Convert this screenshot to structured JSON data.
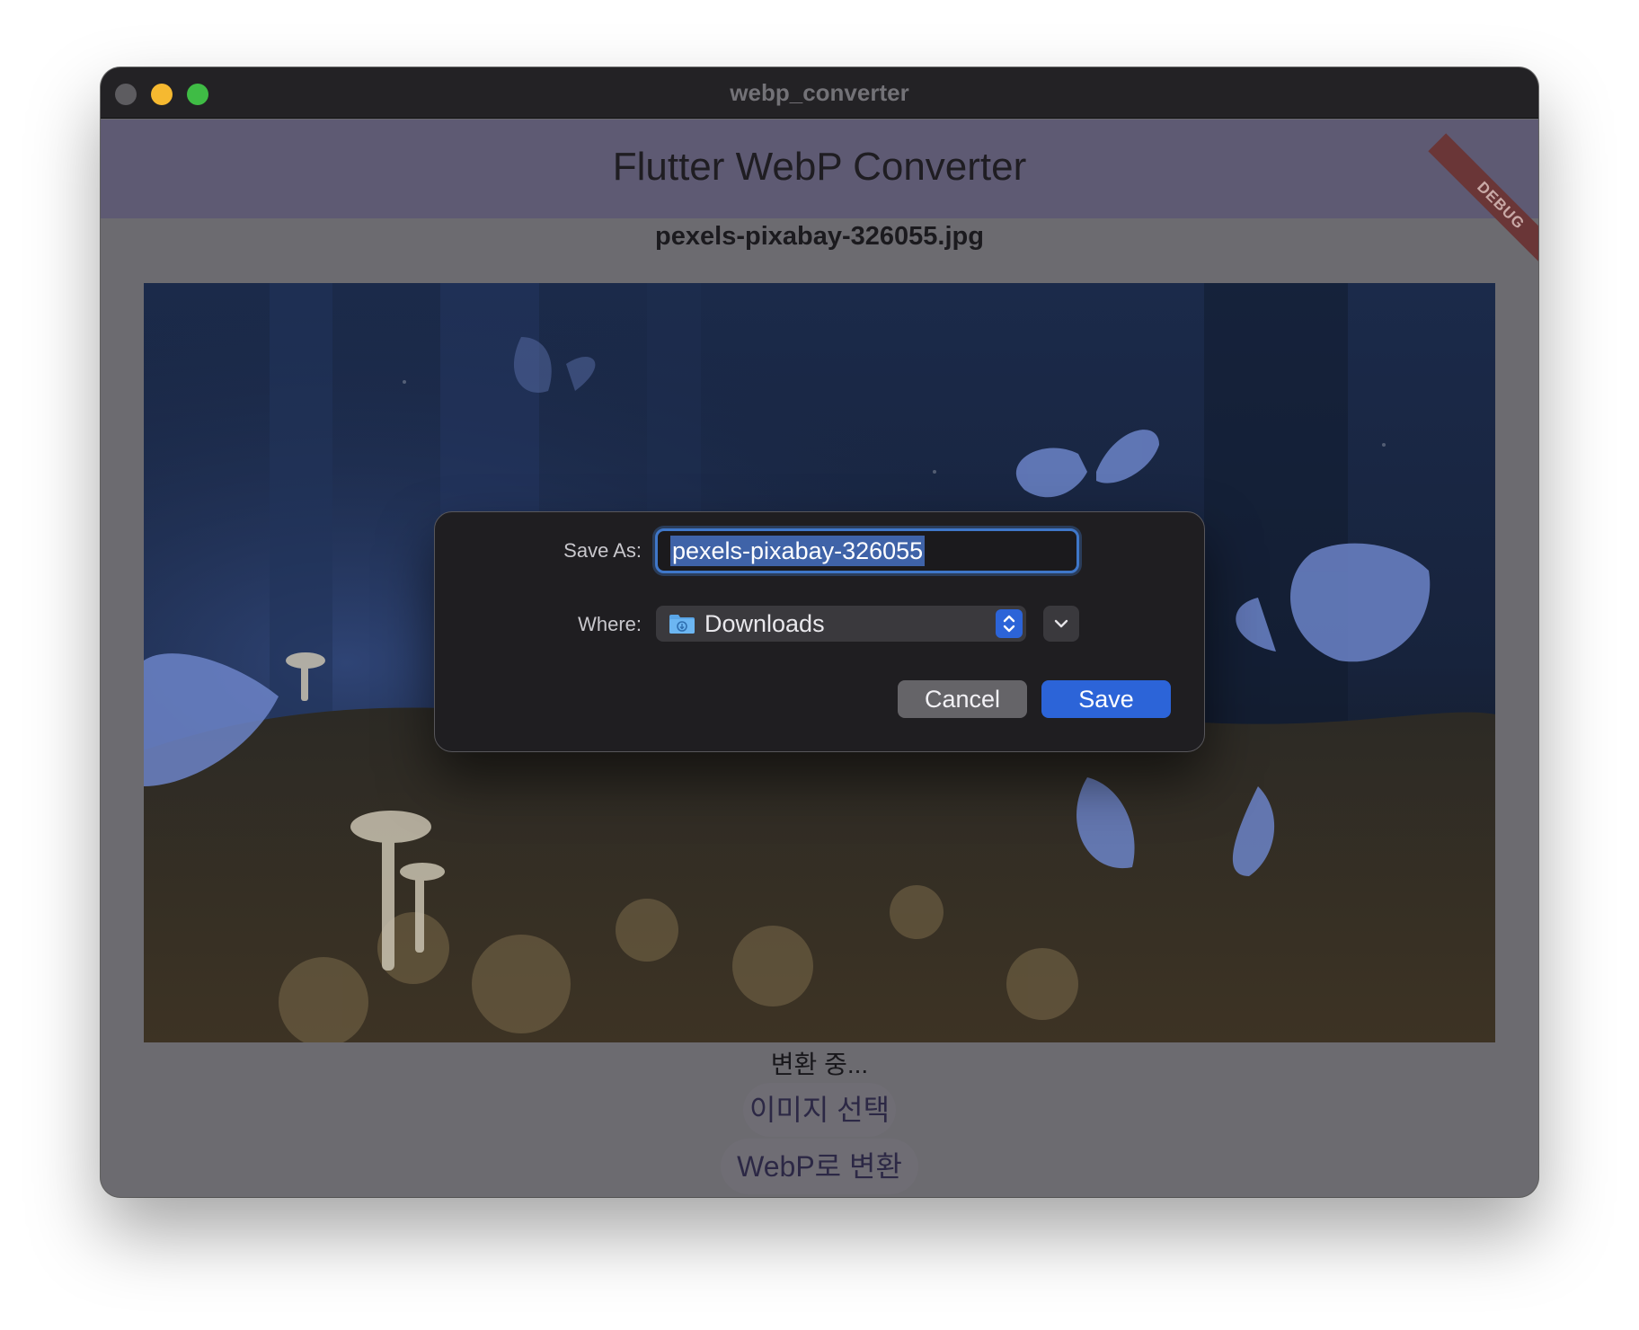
{
  "window": {
    "title": "webp_converter"
  },
  "app": {
    "title": "Flutter WebP Converter",
    "debug_banner": "DEBUG",
    "filename": "pexels-pixabay-326055.jpg",
    "status": "변환 중...",
    "select_image_button": "이미지 선택",
    "convert_button": "WebP로 변환"
  },
  "save_dialog": {
    "save_as_label": "Save As:",
    "save_as_value": "pexels-pixabay-326055",
    "where_label": "Where:",
    "where_value": "Downloads",
    "where_icon": "downloads-folder-icon",
    "cancel_label": "Cancel",
    "save_label": "Save"
  },
  "colors": {
    "accent": "#2c64d8",
    "appbar": "#5e5a73",
    "dialog_bg": "#1f1e21"
  }
}
